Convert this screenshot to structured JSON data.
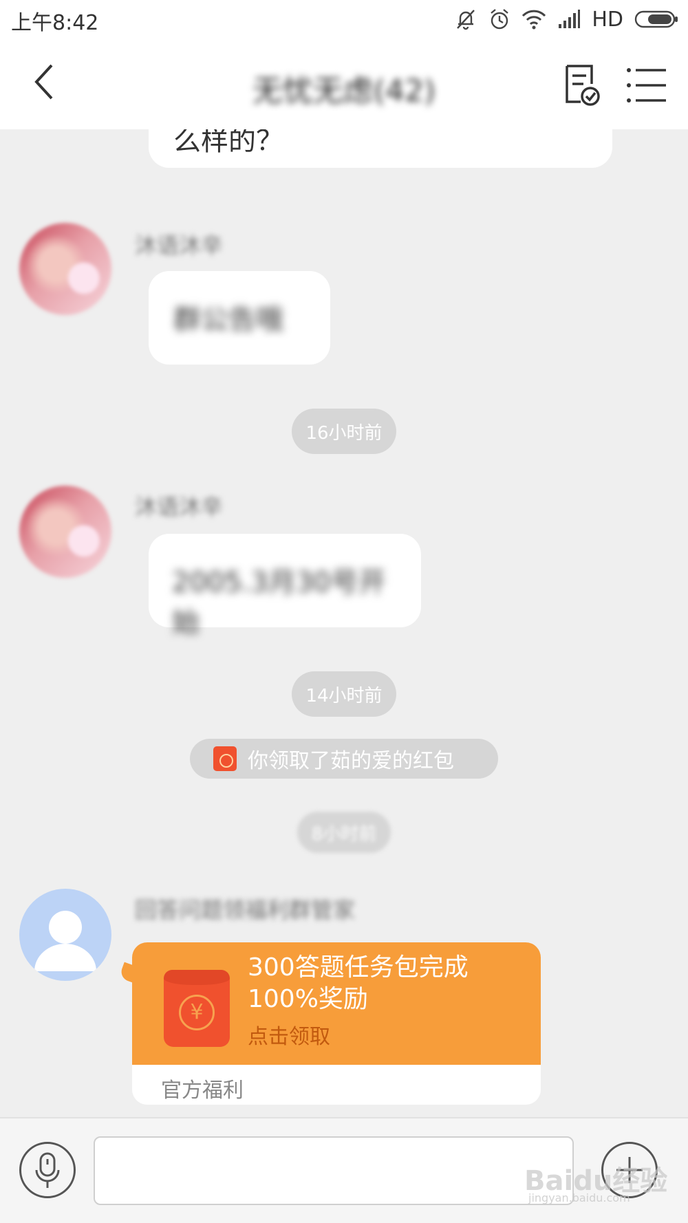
{
  "status_bar": {
    "time": "上午8:42",
    "network_label": "HD"
  },
  "header": {
    "title": "无忧无虑(42)",
    "icons": [
      "back-arrow-icon",
      "notice-icon",
      "menu-icon"
    ]
  },
  "messages": [
    {
      "type": "text",
      "text": "么样的？"
    },
    {
      "type": "text",
      "sender": "沐语沐辛",
      "text": "群公告哦"
    },
    {
      "type": "time",
      "text": "16小时前"
    },
    {
      "type": "text",
      "sender": "沐语沐辛",
      "text": "2005.3月30号开始"
    },
    {
      "type": "time",
      "text": "14小时前"
    },
    {
      "type": "notice",
      "text": "你领取了茹的爱的红包"
    },
    {
      "type": "time",
      "text": "8小时前"
    },
    {
      "type": "red_packet",
      "sender": "回答问题领福利群管家",
      "title": "300答题任务包完成100%奖励",
      "action": "点击领取",
      "footer": "官方福利"
    }
  ],
  "input_bar": {
    "placeholder": "",
    "watermark": "Baidu经验",
    "watermark_sub": "jingyan.baidu.com"
  },
  "colors": {
    "red_packet_orange": "#f79d3a",
    "envelope_red": "#f0512e",
    "chat_background": "#efefef",
    "time_pill": "#d6d6d6"
  }
}
